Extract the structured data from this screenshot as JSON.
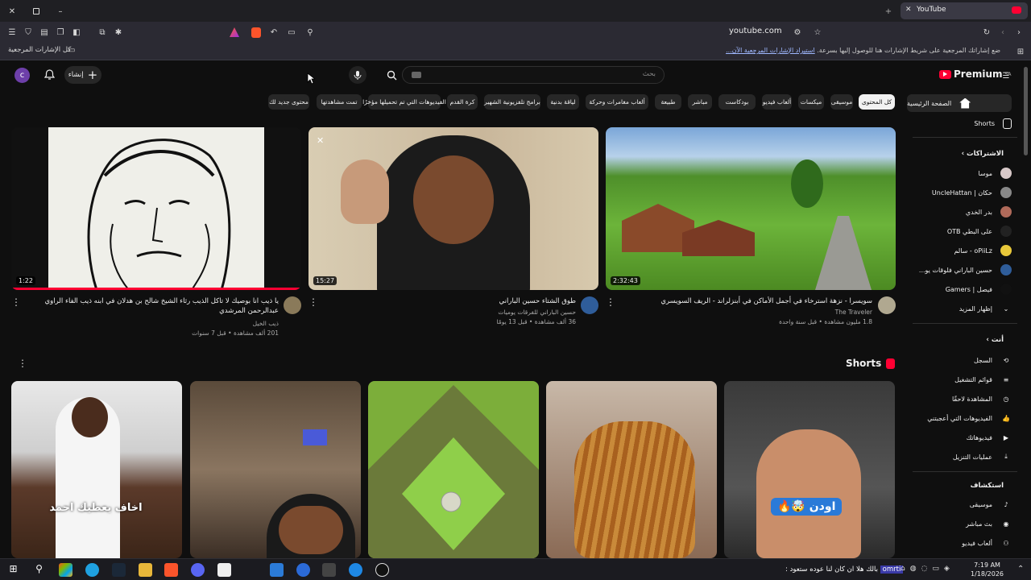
{
  "browser": {
    "tab_title": "YouTube",
    "url": "youtube.com",
    "bookmarks_folder": "كل الإشارات المرجعية",
    "bookmarks_hint": "ضع إشاراتك المرجعية على شريط الإشارات هنا للوصول إليها بسرعة.",
    "bookmarks_import": "استيراد الإشارات المرجعية الآن..."
  },
  "header": {
    "logo_text": "Premium",
    "logo_sup": "SA",
    "search_placeholder": "بحث",
    "create_label": "إنشاء",
    "avatar_letter": "c"
  },
  "chips": [
    "كل المحتوى",
    "موسيقى",
    "ميكسات",
    "ألعاب فيديو",
    "بودكاست",
    "مباشر",
    "طبيعة",
    "ألعاب مغامرات وحركة",
    "لياقة بدنية",
    "برامج تلفزيونية الشهير",
    "كرة القدم",
    "الفيديوهات التي تم تحميلها مؤخرًا",
    "تمت مشاهدتها",
    "محتوى جديد لك"
  ],
  "videos": [
    {
      "title": "سويسرا - نزهة استرخاء في أجمل الأماكن في أبنزلراند - الريف السويسري",
      "channel": "The Traveler",
      "meta": "1.8 مليون مشاهدة • قبل سنة واحدة",
      "duration": "2:32:43"
    },
    {
      "title": "طوق الشتاء حسين الباراني",
      "channel": "حسين الباراني للفرقات يوميات",
      "meta": "36 ألف مشاهدة • قبل 13 يومًا",
      "duration": "15:27"
    },
    {
      "title": "يا ذيب انا بوصيك لا تاكل الذيب رثاء الشيخ شالح بن هدلان في ابنه ذيب الفاء الراوي عبدالرحمن المرشدي",
      "channel": "ذيب الخيل",
      "meta": "201 ألف مشاهدة • قبل 7 سنوات",
      "duration": "1:22"
    }
  ],
  "shorts_title": "Shorts",
  "shorts_overlays": [
    "اودن 🤯🔥",
    "",
    "",
    "",
    "اخاف يعطيك احمد"
  ],
  "sidebar": {
    "home": "الصفحة الرئيسية",
    "shorts": "Shorts",
    "subscriptions_head": "الاشتراكات",
    "subscriptions": [
      "موسا",
      "حكان | UncleHattan",
      "بدر الخدي",
      "على البطي OTB",
      "oPiiLz - سالم",
      "حسين الباراني فلوقات يو...",
      "فيصل | Gamers",
      "إظهار المزيد"
    ],
    "you_head": "أنت",
    "you_items": [
      "السجل",
      "قوائم التشغيل",
      "المشاهدة لاحقًا",
      "الفيديوهات التي أعجبتني",
      "فيديوهاتك",
      "عمليات التنزيل"
    ],
    "explore_head": "استكشاف",
    "explore_items": [
      "موسيقى",
      "بث مباشر",
      "ألعاب فيديو"
    ]
  },
  "taskbar": {
    "ticker_user": "omrti",
    "ticker_text": "بالك هلا ان كان لنا عوده ستعود :",
    "time": "7:19 AM",
    "date": "1/18/2026"
  },
  "colors": {
    "yt_red": "#ff0033",
    "bg": "#0f0f0f",
    "chip": "#272727"
  }
}
